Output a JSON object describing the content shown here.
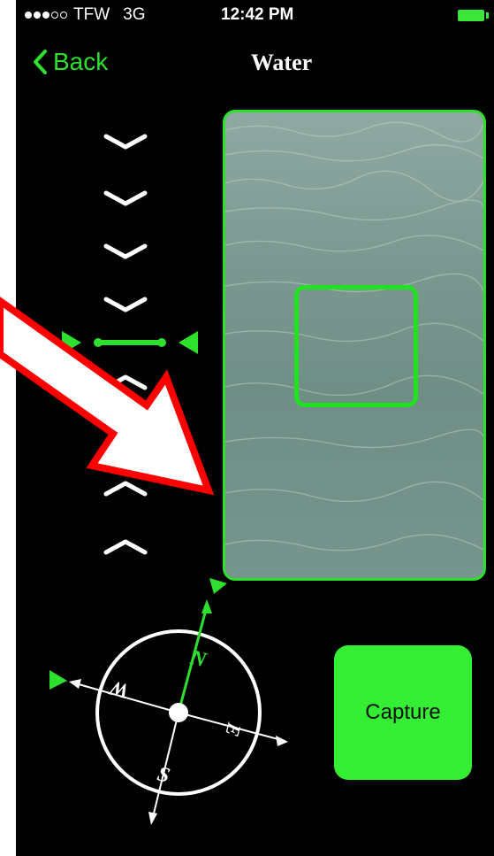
{
  "status_bar": {
    "carrier": "TFW",
    "network": "3G",
    "time": "12:42 PM"
  },
  "nav": {
    "back_label": "Back",
    "title": "Water"
  },
  "compass": {
    "north": "N",
    "east": "E",
    "south": "S",
    "west": "W"
  },
  "capture": {
    "label": "Capture"
  },
  "colors": {
    "accent": "#2ee02e",
    "annotation_arrow": "#ff0000"
  }
}
